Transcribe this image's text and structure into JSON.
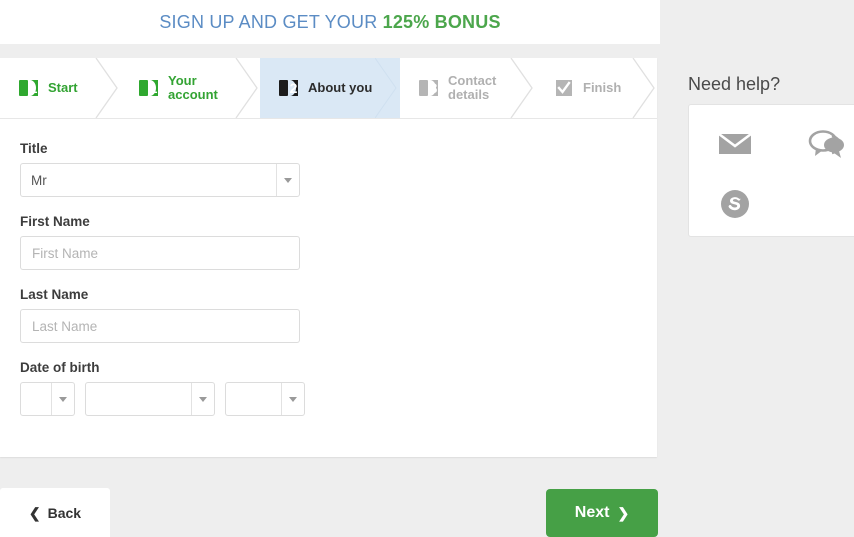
{
  "header": {
    "promo_prefix": "SIGN UP AND GET YOUR ",
    "promo_bonus": "125% BONUS",
    "prefix_color": "#5b8cc4",
    "bonus_color": "#4ca64c"
  },
  "wizard": {
    "active_step_bg": "#dae8f5",
    "steps": [
      {
        "key": "start",
        "label": "Start",
        "icon": "step-number-1-green-icon",
        "state": "complete"
      },
      {
        "key": "account",
        "label": "Your\naccount",
        "icon": "step-number-1-green-icon",
        "state": "complete"
      },
      {
        "key": "about",
        "label": "About you",
        "icon": "step-number-2-dark-icon",
        "state": "active"
      },
      {
        "key": "contact",
        "label": "Contact\ndetails",
        "icon": "step-number-3-grey-icon",
        "state": "upcoming"
      },
      {
        "key": "finish",
        "label": "Finish",
        "icon": "check-badge-grey-icon",
        "state": "upcoming"
      }
    ]
  },
  "form": {
    "title": {
      "label": "Title",
      "value": "Mr"
    },
    "first_name": {
      "label": "First Name",
      "value": "",
      "placeholder": "First Name"
    },
    "last_name": {
      "label": "Last Name",
      "value": "",
      "placeholder": "Last Name"
    },
    "date_of_birth": {
      "label": "Date of birth",
      "day": "",
      "month": "",
      "year": ""
    }
  },
  "footer": {
    "back_label": "Back",
    "back_icon": "chevron-left-icon",
    "next_label": "Next",
    "next_icon": "chevron-right-icon",
    "next_bg": "#46a046"
  },
  "help": {
    "title": "Need help?",
    "icons": [
      {
        "key": "email",
        "name": "envelope-icon"
      },
      {
        "key": "chat",
        "name": "chat-bubbles-icon"
      },
      {
        "key": "skype",
        "name": "skype-icon"
      }
    ]
  }
}
